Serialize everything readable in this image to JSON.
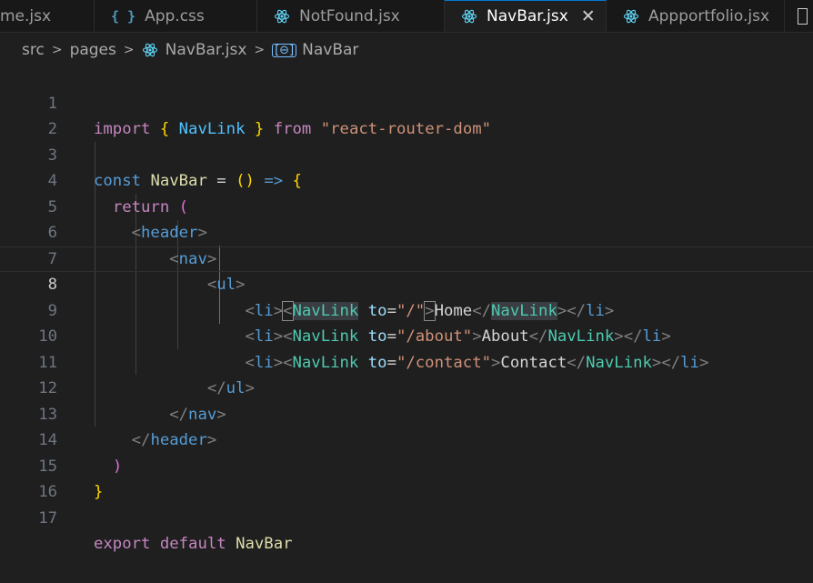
{
  "tabs": [
    {
      "label": "me.jsx",
      "icon": "react-icon",
      "active": false
    },
    {
      "label": "App.css",
      "icon": "css-braces-icon",
      "active": false
    },
    {
      "label": "NotFound.jsx",
      "icon": "react-icon",
      "active": false
    },
    {
      "label": "NavBar.jsx",
      "icon": "react-icon",
      "active": true
    },
    {
      "label": "Appportfolio.jsx",
      "icon": "react-icon",
      "active": false
    }
  ],
  "close_glyph": "✕",
  "breadcrumb": {
    "parts": [
      "src",
      "pages",
      "NavBar.jsx",
      "NavBar"
    ],
    "separator": ">",
    "symbol_glyph": "[⊖]"
  },
  "editor": {
    "current_line": 8,
    "lines": [
      {
        "n": "1"
      },
      {
        "n": "2"
      },
      {
        "n": "3"
      },
      {
        "n": "4"
      },
      {
        "n": "5"
      },
      {
        "n": "6"
      },
      {
        "n": "7"
      },
      {
        "n": "8"
      },
      {
        "n": "9"
      },
      {
        "n": "10"
      },
      {
        "n": "11"
      },
      {
        "n": "12"
      },
      {
        "n": "13"
      },
      {
        "n": "14"
      },
      {
        "n": "15"
      },
      {
        "n": "16"
      },
      {
        "n": "17"
      }
    ],
    "tokens": {
      "import": "import",
      "lbrace": "{",
      "navlink": "NavLink",
      "rbrace": "}",
      "from": "from",
      "module": "\"react-router-dom\"",
      "const": "const",
      "navbar": "NavBar",
      "eq": "=",
      "parens": "()",
      "arrow": "=>",
      "return": "return",
      "lparen": "(",
      "rparen": ")",
      "lt": "<",
      "gt": ">",
      "ltslash": "</",
      "header": "header",
      "nav": "nav",
      "ul": "ul",
      "li": "li",
      "to": "to",
      "eqsign": "=",
      "path_home": "\"/\"",
      "path_about": "\"/about\"",
      "path_contact": "\"/contact\"",
      "home": "Home",
      "about": "About",
      "contact": "Contact",
      "export": "export",
      "default": "default"
    }
  },
  "colors": {
    "background": "#1f1f1f",
    "keyword": "#569cd6",
    "control": "#c586c0",
    "string": "#ce9178",
    "component": "#4ec9b0",
    "attribute": "#9cdcfe"
  }
}
